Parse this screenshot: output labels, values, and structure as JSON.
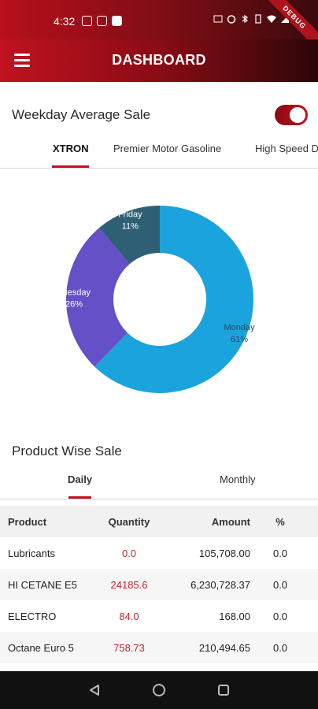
{
  "status_bar": {
    "time": "4:32",
    "debug_banner": "DEBUG"
  },
  "app_bar": {
    "title": "DASHBOARD",
    "menu_icon": "hamburger-menu-icon"
  },
  "weekday_section": {
    "title": "Weekday Average Sale",
    "toggle_on": true,
    "tabs": [
      {
        "label": "XTRON",
        "active": true
      },
      {
        "label": "Premier Motor Gasoline",
        "active": false
      },
      {
        "label": "High Speed D",
        "active": false
      }
    ]
  },
  "chart_data": {
    "type": "pie",
    "donut": true,
    "slices": [
      {
        "label": "Monday",
        "value": 61,
        "value_label": "61%",
        "color": "#1aa3dc"
      },
      {
        "label": "Tuesday",
        "value": 26,
        "value_label": "26%",
        "color": "#6650c8"
      },
      {
        "label": "Friday",
        "value": 11,
        "value_label": "11%",
        "color": "#2e5f75"
      }
    ]
  },
  "product_section": {
    "title": "Product Wise Sale",
    "tabs": [
      {
        "label": "Daily",
        "active": true
      },
      {
        "label": "Monthly",
        "active": false
      }
    ],
    "table": {
      "headers": {
        "product": "Product",
        "quantity": "Quantity",
        "amount": "Amount",
        "percent": "%"
      },
      "rows": [
        {
          "product": "Lubricants",
          "quantity": "0.0",
          "amount": "105,708.00",
          "percent": "0.0"
        },
        {
          "product": "HI CETANE E5",
          "quantity": "24185.6",
          "amount": "6,230,728.37",
          "percent": "0.0"
        },
        {
          "product": "ELECTRO",
          "quantity": "84.0",
          "amount": "168.00",
          "percent": "0.0"
        },
        {
          "product": "Octane Euro 5",
          "quantity": "758.73",
          "amount": "210,494.65",
          "percent": "0.0"
        }
      ]
    }
  },
  "nav_bar": {
    "back_icon": "back-triangle-icon",
    "home_icon": "home-circle-icon",
    "recents_icon": "recents-square-icon"
  }
}
